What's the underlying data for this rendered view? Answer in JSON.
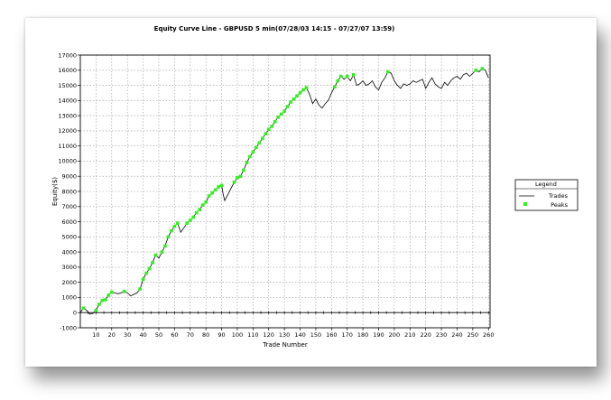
{
  "chart_data": {
    "type": "line",
    "title": "Equity Curve Line - GBPUSD 5 min(07/28/03 14:15 - 07/27/07 13:59)",
    "xlabel": "Trade Number",
    "ylabel": "Equity($)",
    "xlim": [
      0,
      261
    ],
    "ylim": [
      -1000,
      17000
    ],
    "x_ticks": [
      10,
      20,
      30,
      40,
      50,
      60,
      70,
      80,
      90,
      100,
      110,
      120,
      130,
      140,
      150,
      160,
      170,
      180,
      190,
      200,
      210,
      220,
      230,
      240,
      250,
      260
    ],
    "y_ticks": [
      -1000,
      0,
      1000,
      2000,
      3000,
      4000,
      5000,
      6000,
      7000,
      8000,
      9000,
      10000,
      11000,
      12000,
      13000,
      14000,
      15000,
      16000,
      17000
    ],
    "grid": true,
    "legend": {
      "title": "Legend",
      "position": "right",
      "entries": [
        {
          "label": "Trades",
          "color": "#000000",
          "style": "line"
        },
        {
          "label": "Peaks",
          "color": "#33ee22",
          "style": "marker"
        }
      ]
    },
    "series": [
      {
        "name": "Trades",
        "color": "#000000",
        "points": [
          [
            0,
            0
          ],
          [
            2,
            300
          ],
          [
            4,
            150
          ],
          [
            6,
            -100
          ],
          [
            8,
            -50
          ],
          [
            10,
            150
          ],
          [
            12,
            550
          ],
          [
            14,
            800
          ],
          [
            16,
            850
          ],
          [
            18,
            1150
          ],
          [
            20,
            1350
          ],
          [
            22,
            1300
          ],
          [
            24,
            1250
          ],
          [
            26,
            1300
          ],
          [
            28,
            1400
          ],
          [
            30,
            1300
          ],
          [
            32,
            1100
          ],
          [
            34,
            1200
          ],
          [
            36,
            1300
          ],
          [
            38,
            1550
          ],
          [
            40,
            2200
          ],
          [
            42,
            2600
          ],
          [
            44,
            2900
          ],
          [
            46,
            3300
          ],
          [
            48,
            3800
          ],
          [
            50,
            3600
          ],
          [
            52,
            4000
          ],
          [
            54,
            4400
          ],
          [
            56,
            5000
          ],
          [
            58,
            5400
          ],
          [
            60,
            5700
          ],
          [
            62,
            5900
          ],
          [
            64,
            5300
          ],
          [
            66,
            5600
          ],
          [
            68,
            5900
          ],
          [
            70,
            6100
          ],
          [
            72,
            6300
          ],
          [
            74,
            6600
          ],
          [
            76,
            6800
          ],
          [
            78,
            7100
          ],
          [
            80,
            7300
          ],
          [
            82,
            7700
          ],
          [
            84,
            7900
          ],
          [
            86,
            8100
          ],
          [
            88,
            8300
          ],
          [
            90,
            8400
          ],
          [
            91,
            7800
          ],
          [
            92,
            7400
          ],
          [
            94,
            7800
          ],
          [
            96,
            8200
          ],
          [
            98,
            8600
          ],
          [
            100,
            8900
          ],
          [
            102,
            9000
          ],
          [
            104,
            9400
          ],
          [
            106,
            9900
          ],
          [
            108,
            10300
          ],
          [
            110,
            10600
          ],
          [
            112,
            10900
          ],
          [
            114,
            11200
          ],
          [
            116,
            11500
          ],
          [
            118,
            11800
          ],
          [
            120,
            12100
          ],
          [
            122,
            12300
          ],
          [
            124,
            12600
          ],
          [
            126,
            12900
          ],
          [
            128,
            13100
          ],
          [
            130,
            13300
          ],
          [
            132,
            13600
          ],
          [
            134,
            13900
          ],
          [
            136,
            14100
          ],
          [
            138,
            14300
          ],
          [
            140,
            14500
          ],
          [
            142,
            14700
          ],
          [
            144,
            14850
          ],
          [
            146,
            14400
          ],
          [
            148,
            13800
          ],
          [
            150,
            14100
          ],
          [
            152,
            13700
          ],
          [
            154,
            13500
          ],
          [
            156,
            13800
          ],
          [
            158,
            14000
          ],
          [
            160,
            14500
          ],
          [
            162,
            14900
          ],
          [
            164,
            15300
          ],
          [
            166,
            15600
          ],
          [
            168,
            15400
          ],
          [
            170,
            15600
          ],
          [
            172,
            15300
          ],
          [
            174,
            15700
          ],
          [
            176,
            15000
          ],
          [
            178,
            15100
          ],
          [
            180,
            15300
          ],
          [
            182,
            15000
          ],
          [
            184,
            15100
          ],
          [
            186,
            15300
          ],
          [
            188,
            14900
          ],
          [
            190,
            14700
          ],
          [
            192,
            15200
          ],
          [
            194,
            15500
          ],
          [
            196,
            15900
          ],
          [
            198,
            15800
          ],
          [
            200,
            15300
          ],
          [
            202,
            15000
          ],
          [
            204,
            14800
          ],
          [
            206,
            15100
          ],
          [
            208,
            15000
          ],
          [
            210,
            15100
          ],
          [
            212,
            15300
          ],
          [
            214,
            15200
          ],
          [
            216,
            15300
          ],
          [
            218,
            15400
          ],
          [
            220,
            14800
          ],
          [
            222,
            15200
          ],
          [
            224,
            15500
          ],
          [
            226,
            15100
          ],
          [
            228,
            14900
          ],
          [
            230,
            14800
          ],
          [
            232,
            15200
          ],
          [
            234,
            15000
          ],
          [
            236,
            15300
          ],
          [
            238,
            15500
          ],
          [
            240,
            15600
          ],
          [
            242,
            15400
          ],
          [
            244,
            15700
          ],
          [
            246,
            15800
          ],
          [
            248,
            15600
          ],
          [
            250,
            15800
          ],
          [
            252,
            16000
          ],
          [
            254,
            15900
          ],
          [
            256,
            16100
          ],
          [
            258,
            16000
          ],
          [
            260,
            15500
          ]
        ]
      },
      {
        "name": "Peaks",
        "color": "#33ee22",
        "points": [
          [
            2,
            300
          ],
          [
            10,
            150
          ],
          [
            12,
            550
          ],
          [
            14,
            800
          ],
          [
            16,
            850
          ],
          [
            18,
            1150
          ],
          [
            20,
            1350
          ],
          [
            28,
            1400
          ],
          [
            38,
            1550
          ],
          [
            40,
            2200
          ],
          [
            42,
            2600
          ],
          [
            44,
            2900
          ],
          [
            46,
            3300
          ],
          [
            48,
            3800
          ],
          [
            52,
            4000
          ],
          [
            54,
            4400
          ],
          [
            56,
            5000
          ],
          [
            58,
            5400
          ],
          [
            60,
            5700
          ],
          [
            62,
            5900
          ],
          [
            68,
            5900
          ],
          [
            70,
            6100
          ],
          [
            72,
            6300
          ],
          [
            74,
            6600
          ],
          [
            76,
            6800
          ],
          [
            78,
            7100
          ],
          [
            80,
            7300
          ],
          [
            82,
            7700
          ],
          [
            84,
            7900
          ],
          [
            86,
            8100
          ],
          [
            88,
            8300
          ],
          [
            90,
            8400
          ],
          [
            98,
            8600
          ],
          [
            100,
            8900
          ],
          [
            102,
            9000
          ],
          [
            104,
            9400
          ],
          [
            106,
            9900
          ],
          [
            108,
            10300
          ],
          [
            110,
            10600
          ],
          [
            112,
            10900
          ],
          [
            114,
            11200
          ],
          [
            116,
            11500
          ],
          [
            118,
            11800
          ],
          [
            120,
            12100
          ],
          [
            122,
            12300
          ],
          [
            124,
            12600
          ],
          [
            126,
            12900
          ],
          [
            128,
            13100
          ],
          [
            130,
            13300
          ],
          [
            132,
            13600
          ],
          [
            134,
            13900
          ],
          [
            136,
            14100
          ],
          [
            138,
            14300
          ],
          [
            140,
            14500
          ],
          [
            142,
            14700
          ],
          [
            144,
            14850
          ],
          [
            162,
            14900
          ],
          [
            164,
            15300
          ],
          [
            166,
            15600
          ],
          [
            170,
            15600
          ],
          [
            174,
            15700
          ],
          [
            196,
            15900
          ],
          [
            252,
            16000
          ],
          [
            256,
            16100
          ]
        ]
      }
    ]
  }
}
